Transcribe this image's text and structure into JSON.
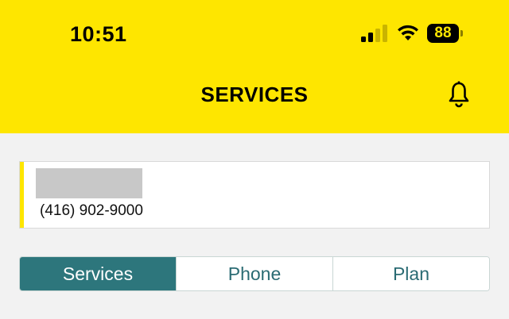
{
  "status_bar": {
    "time": "10:51",
    "battery_level": "88",
    "signal_bars_active": 2,
    "signal_bars_total": 4
  },
  "header": {
    "title": "SERVICES",
    "background_color": "#fee600"
  },
  "account": {
    "phone_number": "(416) 902-9000",
    "accent_color": "#fee600"
  },
  "tabs": [
    {
      "label": "Services",
      "active": true
    },
    {
      "label": "Phone",
      "active": false
    },
    {
      "label": "Plan",
      "active": false
    }
  ],
  "colors": {
    "brand_yellow": "#fee600",
    "tab_active": "#2d767c",
    "tab_text": "#2a6b73"
  },
  "icons": [
    "signal-icon",
    "wifi-icon",
    "battery-icon",
    "bell-icon"
  ]
}
